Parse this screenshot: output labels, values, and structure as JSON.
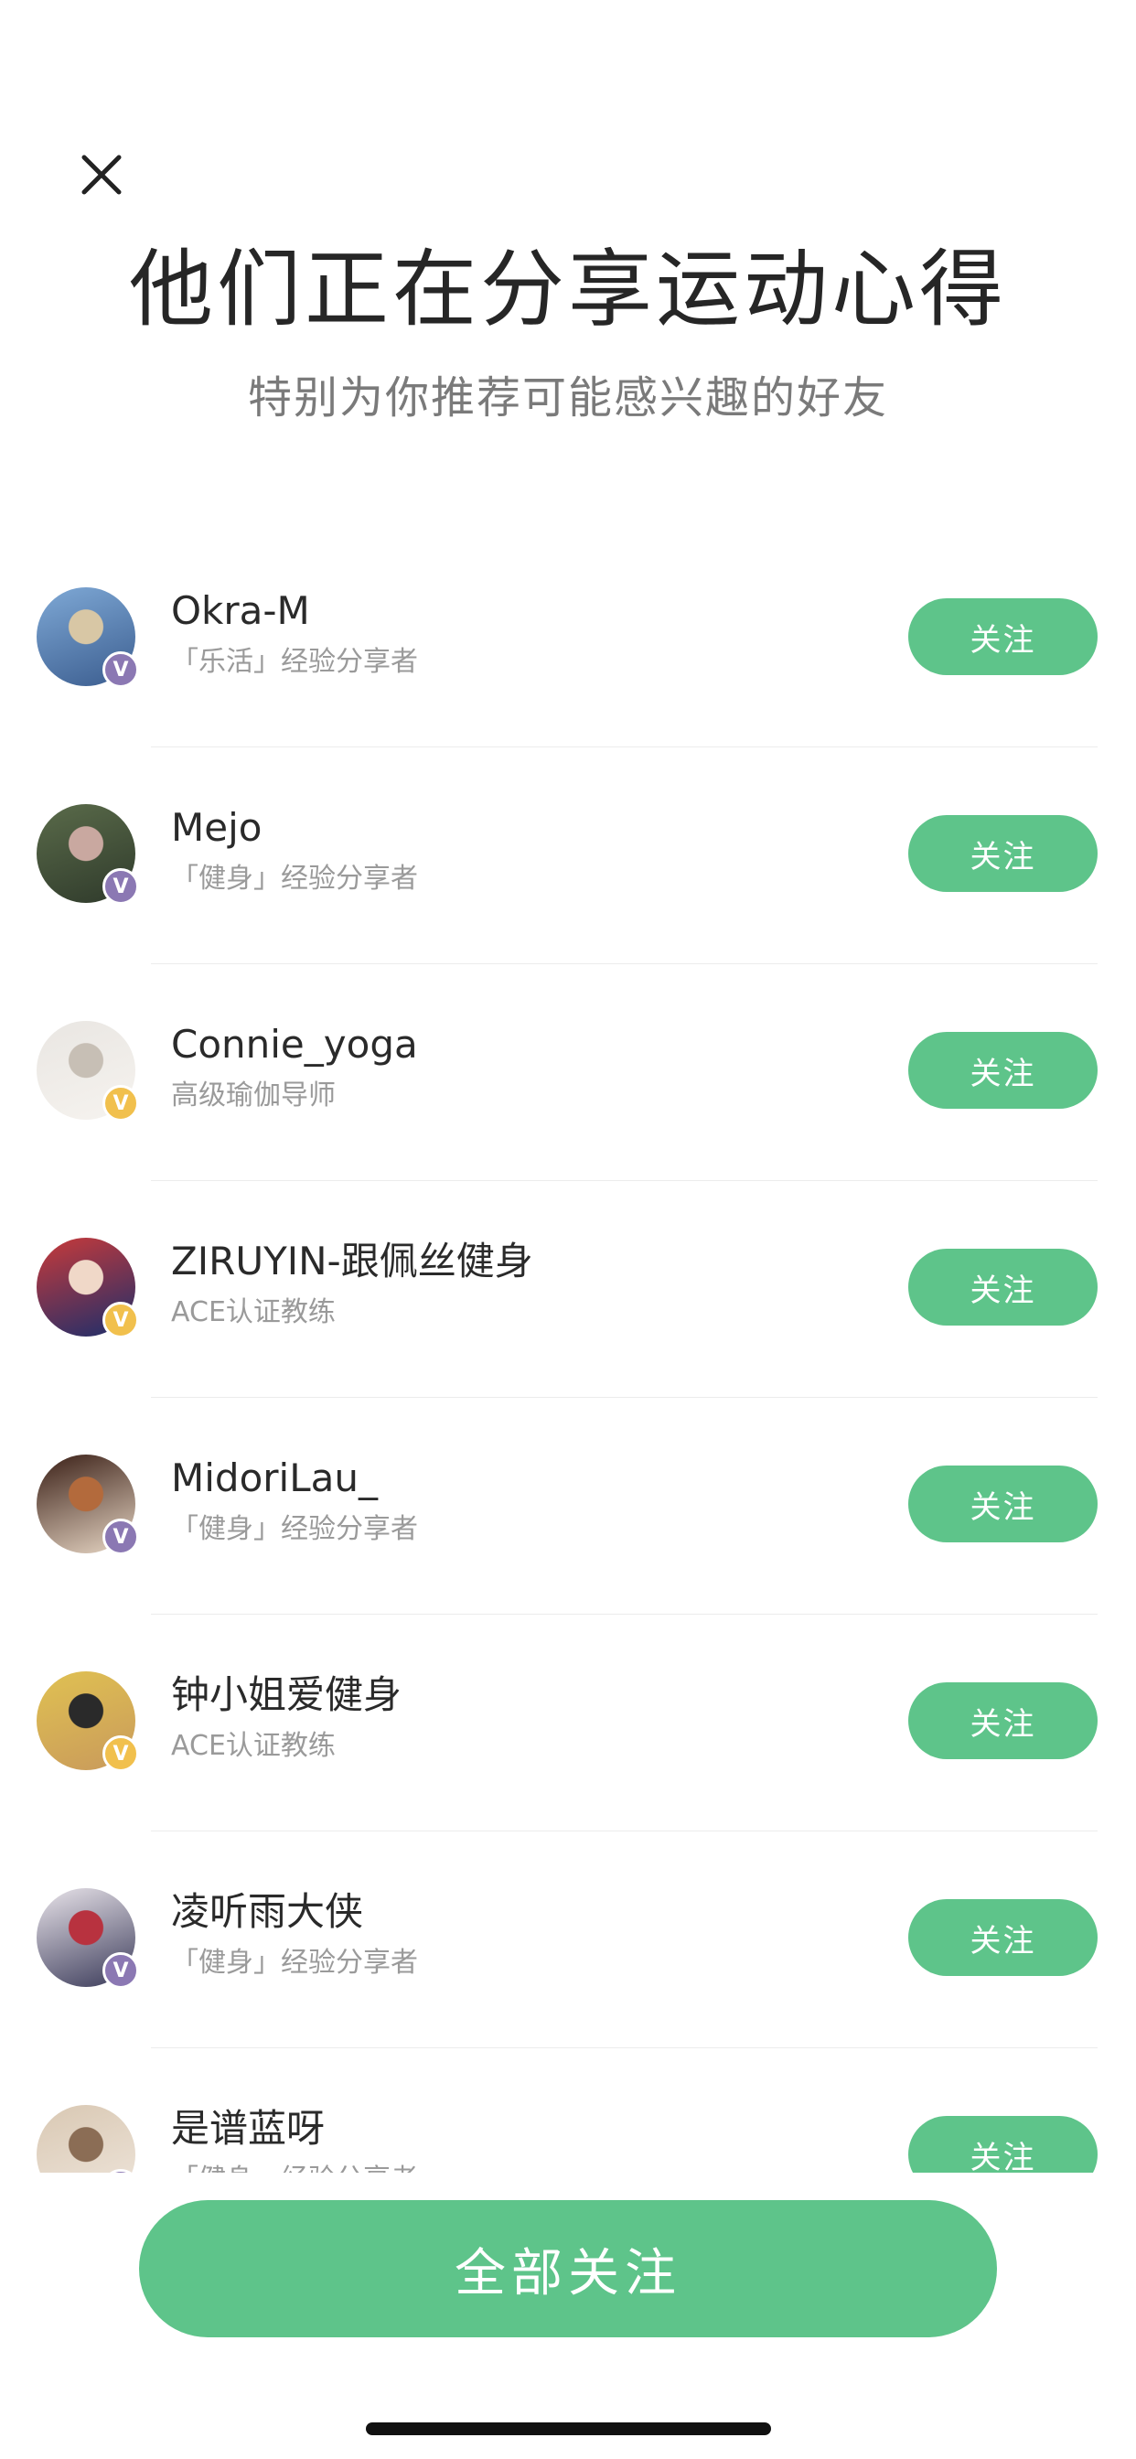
{
  "header": {
    "title": "他们正在分享运动心得",
    "subtitle": "特别为你推荐可能感兴趣的好友"
  },
  "users": [
    {
      "name": "Okra-M",
      "desc": "「乐活」经验分享者",
      "follow_label": "关注",
      "badge": "V",
      "badge_color": "#8b78b3",
      "avatar_colors": [
        "#7fa9d6",
        "#d8c7a5",
        "#3b5d8f"
      ]
    },
    {
      "name": "Mejo",
      "desc": "「健身」经验分享者",
      "follow_label": "关注",
      "badge": "V",
      "badge_color": "#8b78b3",
      "avatar_colors": [
        "#5a6b4a",
        "#c9a8a0",
        "#2f3a2b"
      ]
    },
    {
      "name": "Connie_yoga",
      "desc": "高级瑜伽导师",
      "follow_label": "关注",
      "badge": "V",
      "badge_color": "#f1c04d",
      "avatar_colors": [
        "#e9e6e2",
        "#c7bfb5",
        "#f6f3ef"
      ]
    },
    {
      "name": "ZIRUYIN-跟佩丝健身",
      "desc": "ACE认证教练",
      "follow_label": "关注",
      "badge": "V",
      "badge_color": "#f1c04d",
      "avatar_colors": [
        "#c93a3a",
        "#f0d8c8",
        "#1c2e6b"
      ]
    },
    {
      "name": "MidoriLau_",
      "desc": "「健身」经验分享者",
      "follow_label": "关注",
      "badge": "V",
      "badge_color": "#8b78b3",
      "avatar_colors": [
        "#3a1f16",
        "#b36a3c",
        "#e7d6c4"
      ]
    },
    {
      "name": "钟小姐爱健身",
      "desc": "ACE认证教练",
      "follow_label": "关注",
      "badge": "V",
      "badge_color": "#f1c04d",
      "avatar_colors": [
        "#e0c152",
        "#2a2a2a",
        "#c99a5b"
      ]
    },
    {
      "name": "凌听雨大侠",
      "desc": "「健身」经验分享者",
      "follow_label": "关注",
      "badge": "V",
      "badge_color": "#8b78b3",
      "avatar_colors": [
        "#e9e4ea",
        "#b8323f",
        "#3b3b5a"
      ]
    },
    {
      "name": "是谱蓝呀",
      "desc": "「健身」经验分享者",
      "follow_label": "关注",
      "badge": "V",
      "badge_color": "#8b78b3",
      "avatar_colors": [
        "#d9c8b3",
        "#8b6d55",
        "#efe6dc"
      ]
    }
  ],
  "footer": {
    "follow_all_label": "全部关注"
  },
  "colors": {
    "accent": "#5ec48a",
    "title": "#262626",
    "subtitle": "#7a7a7a",
    "desc": "#9a9a9a"
  }
}
